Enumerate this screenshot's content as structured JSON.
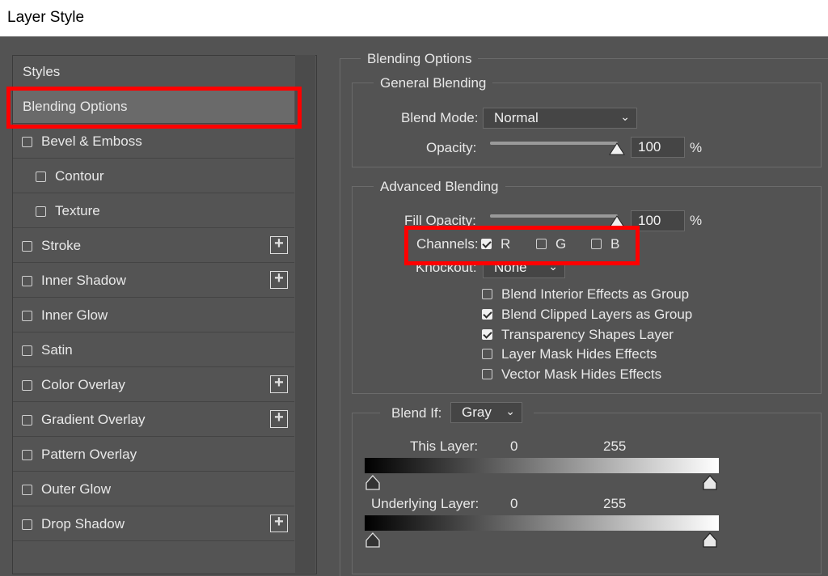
{
  "window": {
    "title": "Layer Style"
  },
  "sidebar": {
    "header": "Styles",
    "items": [
      {
        "label": "Blending Options",
        "checkbox": false,
        "checked": false,
        "indent": false,
        "plus": false,
        "selected": true
      },
      {
        "label": "Bevel & Emboss",
        "checkbox": true,
        "checked": false,
        "indent": false,
        "plus": false,
        "selected": false
      },
      {
        "label": "Contour",
        "checkbox": true,
        "checked": false,
        "indent": true,
        "plus": false,
        "selected": false
      },
      {
        "label": "Texture",
        "checkbox": true,
        "checked": false,
        "indent": true,
        "plus": false,
        "selected": false
      },
      {
        "label": "Stroke",
        "checkbox": true,
        "checked": false,
        "indent": false,
        "plus": true,
        "selected": false
      },
      {
        "label": "Inner Shadow",
        "checkbox": true,
        "checked": false,
        "indent": false,
        "plus": true,
        "selected": false
      },
      {
        "label": "Inner Glow",
        "checkbox": true,
        "checked": false,
        "indent": false,
        "plus": false,
        "selected": false
      },
      {
        "label": "Satin",
        "checkbox": true,
        "checked": false,
        "indent": false,
        "plus": false,
        "selected": false
      },
      {
        "label": "Color Overlay",
        "checkbox": true,
        "checked": false,
        "indent": false,
        "plus": true,
        "selected": false
      },
      {
        "label": "Gradient Overlay",
        "checkbox": true,
        "checked": false,
        "indent": false,
        "plus": true,
        "selected": false
      },
      {
        "label": "Pattern Overlay",
        "checkbox": true,
        "checked": false,
        "indent": false,
        "plus": false,
        "selected": false
      },
      {
        "label": "Outer Glow",
        "checkbox": true,
        "checked": false,
        "indent": false,
        "plus": false,
        "selected": false
      },
      {
        "label": "Drop Shadow",
        "checkbox": true,
        "checked": false,
        "indent": false,
        "plus": true,
        "selected": false
      }
    ]
  },
  "blending": {
    "legend": "Blending Options",
    "general": {
      "legend": "General Blending",
      "blend_mode_label": "Blend Mode:",
      "blend_mode_value": "Normal",
      "opacity_label": "Opacity:",
      "opacity_value": "100",
      "opacity_unit": "%"
    },
    "advanced": {
      "legend": "Advanced Blending",
      "fill_opacity_label": "Fill Opacity:",
      "fill_opacity_value": "100",
      "fill_opacity_unit": "%",
      "channels_label": "Channels:",
      "channels": [
        {
          "label": "R",
          "checked": true
        },
        {
          "label": "G",
          "checked": false
        },
        {
          "label": "B",
          "checked": false
        }
      ],
      "knockout_label": "Knockout:",
      "knockout_value": "None",
      "options": [
        {
          "label": "Blend Interior Effects as Group",
          "checked": false
        },
        {
          "label": "Blend Clipped Layers as Group",
          "checked": true
        },
        {
          "label": "Transparency Shapes Layer",
          "checked": true
        },
        {
          "label": "Layer Mask Hides Effects",
          "checked": false
        },
        {
          "label": "Vector Mask Hides Effects",
          "checked": false
        }
      ]
    },
    "blend_if": {
      "label": "Blend If:",
      "value": "Gray",
      "this_layer_label": "This Layer:",
      "this_layer_min": "0",
      "this_layer_max": "255",
      "underlying_label": "Underlying Layer:",
      "underlying_min": "0",
      "underlying_max": "255"
    }
  },
  "colors": {
    "highlight": "#ff0000",
    "panel": "#535353",
    "selected": "#6a6a6a"
  }
}
